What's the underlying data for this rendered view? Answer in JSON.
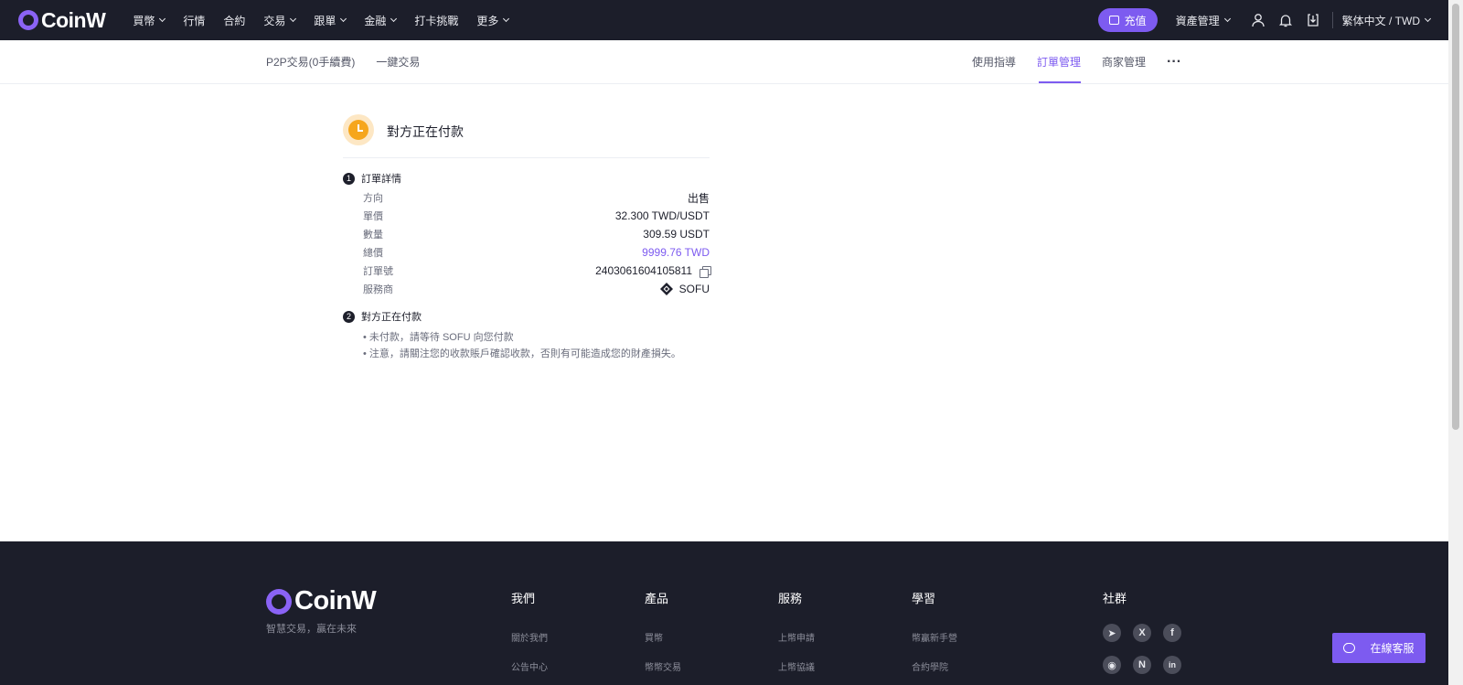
{
  "header": {
    "logo_text": "CoinW",
    "nav": [
      {
        "label": "買幣",
        "has_dropdown": true
      },
      {
        "label": "行情",
        "has_dropdown": false
      },
      {
        "label": "合約",
        "has_dropdown": false
      },
      {
        "label": "交易",
        "has_dropdown": true
      },
      {
        "label": "跟單",
        "has_dropdown": true
      },
      {
        "label": "金融",
        "has_dropdown": true
      },
      {
        "label": "打卡挑戰",
        "has_dropdown": false
      },
      {
        "label": "更多",
        "has_dropdown": true
      }
    ],
    "deposit_label": "充值",
    "assets_label": "資產管理",
    "language_label": "繁体中文 / TWD",
    "icons": [
      "user-icon",
      "bell-icon",
      "download-icon"
    ]
  },
  "subnav": {
    "left_tabs": [
      "P2P交易(0手續費)",
      "一鍵交易"
    ],
    "right_tabs": [
      {
        "label": "使用指導",
        "active": false
      },
      {
        "label": "訂單管理",
        "active": true
      },
      {
        "label": "商家管理",
        "active": false
      }
    ],
    "more_label": "···"
  },
  "order": {
    "status_title": "對方正在付款",
    "section1_num": "1",
    "section1_title": "訂單詳情",
    "details": [
      {
        "label": "方向",
        "value": "出售"
      },
      {
        "label": "單價",
        "value": "32.300 TWD/USDT"
      },
      {
        "label": "數量",
        "value": "309.59 USDT"
      },
      {
        "label": "總價",
        "value": "9999.76 TWD"
      },
      {
        "label": "訂單號",
        "value": "2403061604105811"
      },
      {
        "label": "服務商",
        "value": "SOFU"
      }
    ],
    "section2_num": "2",
    "section2_title": "對方正在付款",
    "notes": [
      "• 未付款，請等待 SOFU 向您付款",
      "• 注意，請關注您的收款賬戶確認收款，否則有可能造成您的財產損失。"
    ]
  },
  "colors": {
    "accent": "#7d5bf0",
    "header_bg": "#1c1e2a",
    "status_orange": "#f6a61c"
  },
  "footer": {
    "logo_text": "CoinW",
    "slogan": "智慧交易，贏在未來",
    "columns": [
      {
        "title": "我們",
        "links": [
          "關於我們",
          "公告中心"
        ]
      },
      {
        "title": "產品",
        "links": [
          "買幣",
          "幣幣交易"
        ]
      },
      {
        "title": "服務",
        "links": [
          "上幣申請",
          "上幣協議"
        ]
      },
      {
        "title": "學習",
        "links": [
          "幣贏新手營",
          "合約學院"
        ]
      }
    ],
    "social_title": "社群",
    "social": [
      {
        "icon": "telegram-icon",
        "glyph": "➤"
      },
      {
        "icon": "x-icon",
        "glyph": "X"
      },
      {
        "icon": "facebook-icon",
        "glyph": "f"
      },
      {
        "icon": "weibo-icon",
        "glyph": "◉"
      },
      {
        "icon": "naver-icon",
        "glyph": "N"
      },
      {
        "icon": "linkedin-icon",
        "glyph": "in"
      }
    ]
  },
  "chat": {
    "label": "在線客服"
  }
}
